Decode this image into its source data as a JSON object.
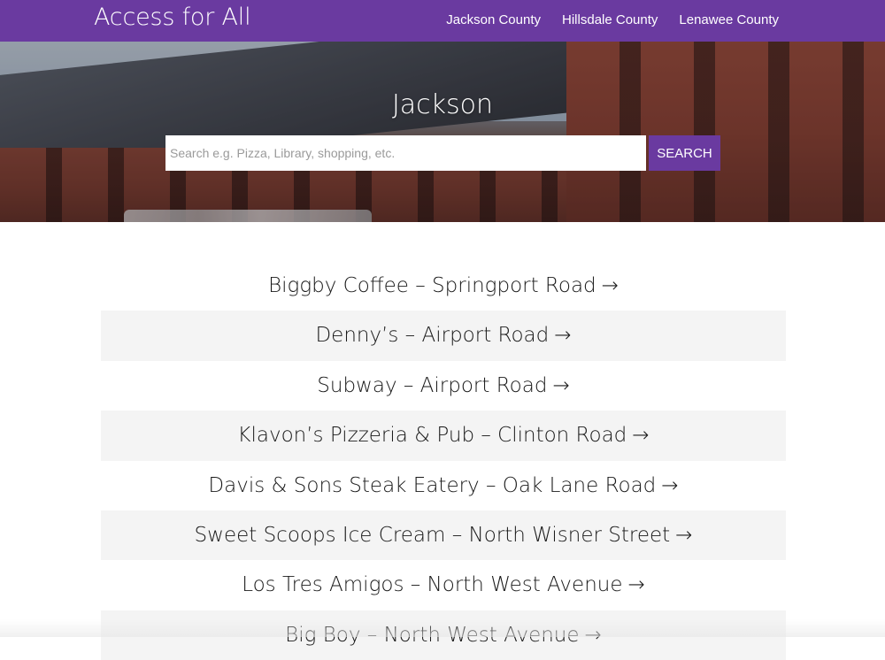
{
  "header": {
    "site_title": "Access for All",
    "nav": [
      "Jackson County",
      "Hillsdale County",
      "Lenawee County"
    ],
    "brand_color": "#6a3aa0"
  },
  "hero": {
    "title": "Jackson",
    "search": {
      "placeholder": "Search e.g. Pizza, Library, shopping, etc.",
      "value": "",
      "button_label": "SEARCH"
    }
  },
  "listings": [
    "Biggby Coffee – Springport Road",
    "Denny’s – Airport Road",
    "Subway – Airport Road",
    "Klavon’s Pizzeria & Pub – Clinton Road",
    "Davis & Sons Steak Eatery – Oak Lane Road",
    "Sweet Scoops Ice Cream – North Wisner Street",
    "Los Tres Amigos – North West Avenue",
    "Big Boy – North West Avenue"
  ],
  "listing_arrow": "→"
}
